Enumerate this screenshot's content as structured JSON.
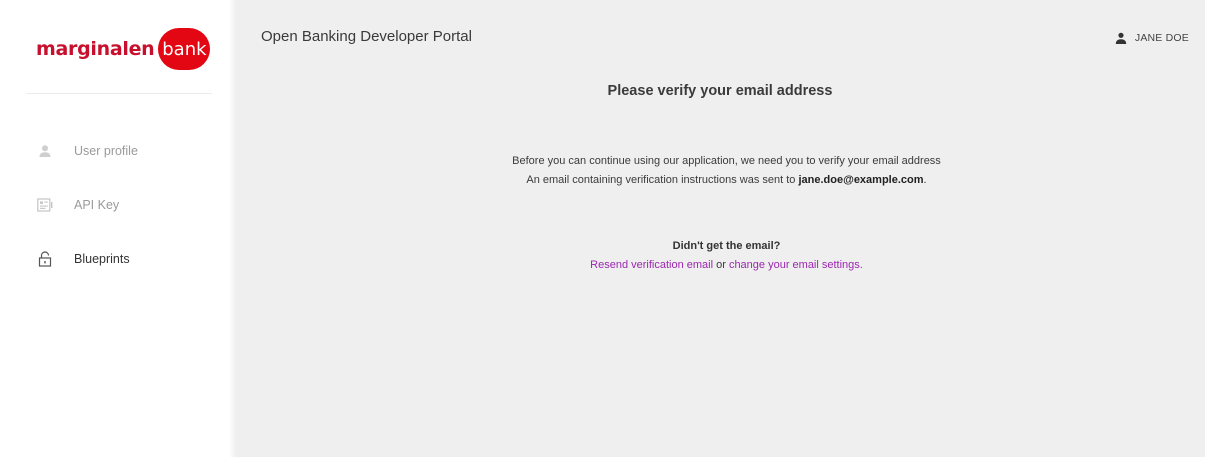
{
  "sidebar": {
    "logo": {
      "word": "marginalen",
      "badge": "bank"
    },
    "items": [
      {
        "label": "User profile",
        "icon": "user-icon"
      },
      {
        "label": "API Key",
        "icon": "key-card-icon"
      },
      {
        "label": "Blueprints",
        "icon": "lock-icon"
      }
    ]
  },
  "header": {
    "title": "Open Banking Developer Portal",
    "user_name": "JANE DOE",
    "user_icon": "person-icon"
  },
  "main": {
    "heading": "Please verify your email address",
    "line1": "Before you can continue using our application, we need you to verify your email address",
    "line2_prefix": "An email containing verification instructions was sent to ",
    "email": "jane.doe@example.com",
    "line2_suffix": ".",
    "question": "Didn't get the email?",
    "resend_link": "Resend verification email",
    "or_text": " or ",
    "settings_link": "change your email settings."
  },
  "colors": {
    "brand": "#e30613",
    "link": "#9c27b0",
    "main_background": "#efefef"
  }
}
